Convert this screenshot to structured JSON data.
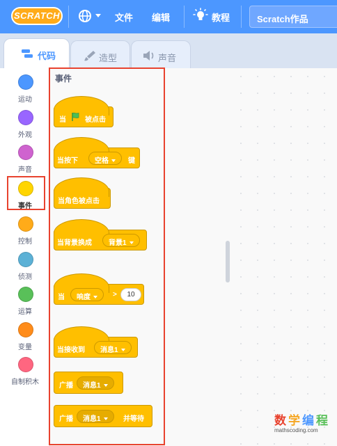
{
  "menubar": {
    "logo_text": "SCRATCH",
    "file": "文件",
    "edit": "编辑",
    "tutorials": "教程",
    "project_title": "Scratch作品"
  },
  "tabs": [
    {
      "label": "代码",
      "icon": "code-icon",
      "active": true
    },
    {
      "label": "造型",
      "icon": "brush-icon",
      "active": false
    },
    {
      "label": "声音",
      "icon": "speaker-icon",
      "active": false
    }
  ],
  "categories": [
    {
      "label": "运动",
      "color": "#4C97FF"
    },
    {
      "label": "外观",
      "color": "#9966FF"
    },
    {
      "label": "声音",
      "color": "#CF63CF"
    },
    {
      "label": "事件",
      "color": "#FFD500",
      "selected": true
    },
    {
      "label": "控制",
      "color": "#FFAB19"
    },
    {
      "label": "侦测",
      "color": "#5CB1D6"
    },
    {
      "label": "运算",
      "color": "#59C059"
    },
    {
      "label": "变量",
      "color": "#FF8C1A"
    },
    {
      "label": "自制积木",
      "color": "#FF6680"
    }
  ],
  "palette": {
    "section_title": "事件",
    "blocks": {
      "flag_clicked": {
        "prefix": "当",
        "suffix": "被点击"
      },
      "key_pressed": {
        "prefix": "当按下",
        "key": "空格",
        "suffix": "键"
      },
      "sprite_clicked": {
        "text": "当角色被点击"
      },
      "backdrop_switch": {
        "prefix": "当背景换成",
        "backdrop": "背景1"
      },
      "greater_than": {
        "prefix": "当",
        "sensor": "响度",
        "op": ">",
        "value": "10"
      },
      "receive": {
        "prefix": "当接收到",
        "message": "消息1"
      },
      "broadcast": {
        "prefix": "广播",
        "message": "消息1"
      },
      "broadcast_wait": {
        "prefix": "广播",
        "message": "消息1",
        "suffix": "并等待"
      }
    }
  },
  "watermark": {
    "c1": "数",
    "c2": "学",
    "c3": "编",
    "c4": "程",
    "url": "mathscoding.com"
  },
  "colors": {
    "menubar": "#4C97FF",
    "events": "#FFBF00",
    "highlight": "#E8422E"
  }
}
